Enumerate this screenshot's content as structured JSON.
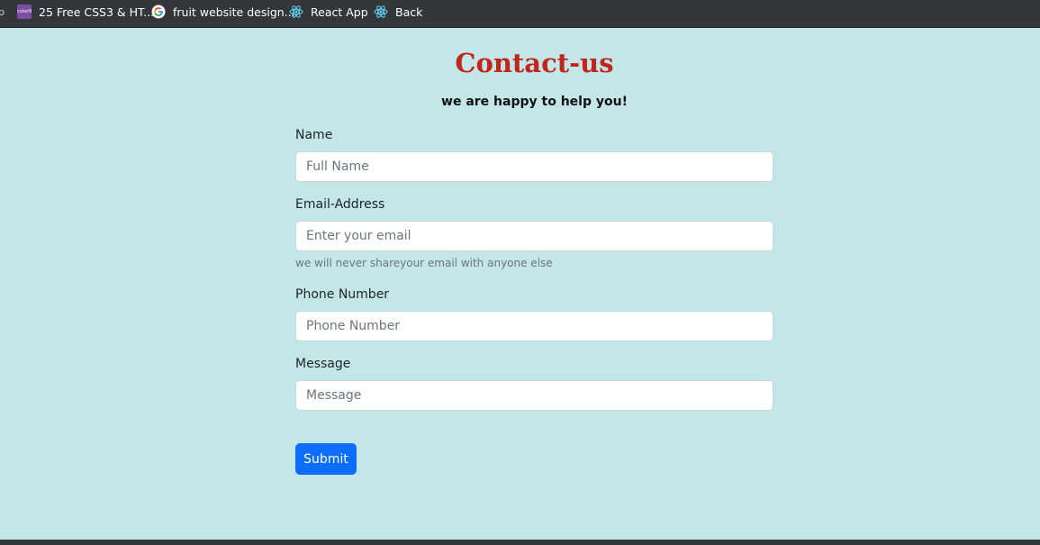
{
  "bookmarks": [
    {
      "label": "25 Free CSS3 & HT...",
      "icon": "colorlib-icon",
      "favicon_text": "colorlib"
    },
    {
      "label": "fruit website design...",
      "icon": "google-icon"
    },
    {
      "label": "React App",
      "icon": "react-icon"
    },
    {
      "label": "Back",
      "icon": "react-icon"
    }
  ],
  "page": {
    "title": "Contact-us",
    "subtitle": "we are happy to help you!"
  },
  "form": {
    "name": {
      "label": "Name",
      "placeholder": "Full Name",
      "value": ""
    },
    "email": {
      "label": "Email-Address",
      "placeholder": "Enter your email",
      "value": "",
      "help": "we will never shareyour email with anyone else"
    },
    "phone": {
      "label": "Phone Number",
      "placeholder": "Phone Number",
      "value": ""
    },
    "message": {
      "label": "Message",
      "placeholder": "Message",
      "value": ""
    },
    "submit_label": "Submit"
  },
  "colors": {
    "page_background": "#c3e6e8",
    "title": "#c0261c",
    "primary_button": "#0d6efd",
    "toolbar": "#35363a"
  }
}
